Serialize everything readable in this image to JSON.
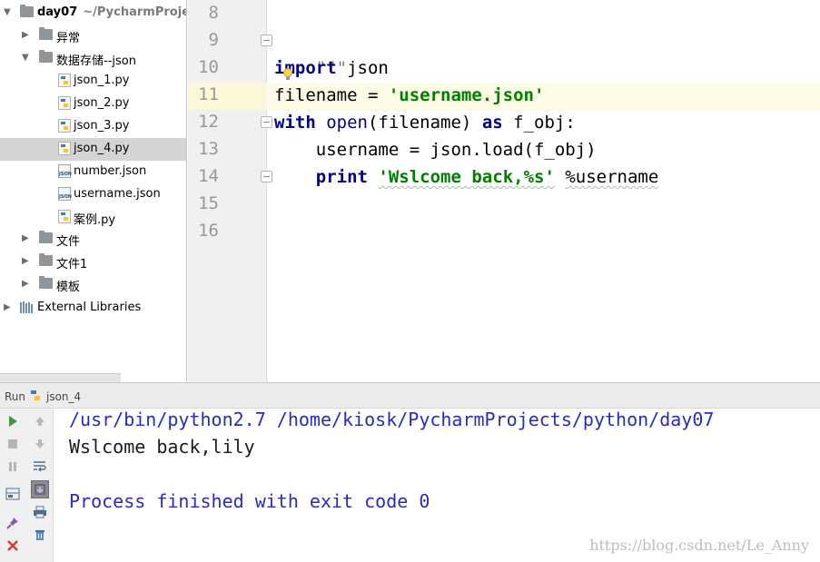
{
  "tree": {
    "root_name": "day07",
    "root_path": "~/PycharmProjects",
    "items": [
      {
        "label": "异常",
        "kind": "folder",
        "expanded": false
      },
      {
        "label": "数据存储--json",
        "kind": "folder",
        "expanded": true
      },
      {
        "label": "json_1.py",
        "kind": "py"
      },
      {
        "label": "json_2.py",
        "kind": "py"
      },
      {
        "label": "json_3.py",
        "kind": "py"
      },
      {
        "label": "json_4.py",
        "kind": "py",
        "selected": true
      },
      {
        "label": "number.json",
        "kind": "json"
      },
      {
        "label": "username.json",
        "kind": "json"
      },
      {
        "label": "案例.py",
        "kind": "py"
      },
      {
        "label": "文件",
        "kind": "folder",
        "expanded": false
      },
      {
        "label": "文件1",
        "kind": "folder",
        "expanded": false
      },
      {
        "label": "模板",
        "kind": "folder",
        "expanded": false
      }
    ],
    "external_libraries": "External Libraries",
    "json_badge": "JSON"
  },
  "editor": {
    "line_numbers": [
      "8",
      "9",
      "10",
      "11",
      "12",
      "13",
      "14",
      "15",
      "16"
    ],
    "line9": {
      "text": "\"\"\""
    },
    "line10": {
      "kw": "import",
      "rest": " json"
    },
    "line11": {
      "lhs": "filename = ",
      "str": "'username.json'"
    },
    "line12": {
      "kw1": "with",
      "sp1": " ",
      "fn": "open",
      "args": "(filename) ",
      "kw2": "as",
      "rest": " f_obj:"
    },
    "line13": {
      "text": "    username = json.load(f_obj)"
    },
    "line14": {
      "indent": "    ",
      "kw": "print",
      "sp": " ",
      "str": "'Wslcome back,%s'",
      "sp2": " ",
      "rest": "%username"
    }
  },
  "run": {
    "label": "Run",
    "config_name": "json_4",
    "output": [
      {
        "text": "/usr/bin/python2.7 /home/kiosk/PycharmProjects/python/day07",
        "color": "blue"
      },
      {
        "text": "Wslcome back,lily",
        "color": "black"
      },
      {
        "text": "",
        "color": "black"
      },
      {
        "text": "Process finished with exit code 0",
        "color": "blue"
      }
    ]
  },
  "watermark": "https://blog.csdn.net/Le_Anny",
  "colors": {
    "keyword": "#000080",
    "string": "#008000",
    "console_blue": "#2b2bb8",
    "selection": "#d4d4d4",
    "current_line": "#fdfbe5"
  },
  "icons": [
    "folder-icon",
    "python-file-icon",
    "json-file-icon",
    "library-icon",
    "run-icon",
    "stop-icon",
    "pause-icon",
    "up-arrow-icon",
    "down-arrow-icon",
    "wrap-icon",
    "scroll-icon",
    "layout-icon",
    "print-icon",
    "pin-icon",
    "trash-icon",
    "close-icon",
    "lightbulb-icon"
  ]
}
